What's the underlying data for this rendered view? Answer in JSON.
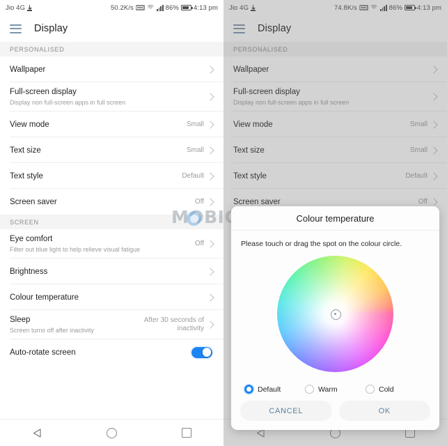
{
  "left": {
    "status_bar": {
      "carrier": "Jio 4G",
      "download_icon": "download-arrow-icon",
      "network_speed": "50.2K/s",
      "hd_icon": "hd-icon",
      "wifi_icon": "wifi-icon",
      "signal_icon": "signal-bars-icon",
      "battery_percent": "86%",
      "battery_icon": "battery-icon",
      "time": "4:13 pm"
    },
    "app_bar": {
      "menu_icon": "hamburger-menu-icon",
      "title": "Display"
    },
    "sections": [
      {
        "header": "PERSONALISED",
        "rows": [
          {
            "title": "Wallpaper",
            "sub": "",
            "value": "",
            "control": "chevron"
          },
          {
            "title": "Full-screen display",
            "sub": "Display non full-screen apps in full screen",
            "value": "",
            "control": "chevron"
          },
          {
            "title": "View mode",
            "sub": "",
            "value": "Small",
            "control": "chevron"
          },
          {
            "title": "Text size",
            "sub": "",
            "value": "Small",
            "control": "chevron"
          },
          {
            "title": "Text style",
            "sub": "",
            "value": "Default",
            "control": "chevron"
          },
          {
            "title": "Screen saver",
            "sub": "",
            "value": "Off",
            "control": "chevron"
          }
        ]
      },
      {
        "header": "SCREEN",
        "rows": [
          {
            "title": "Eye comfort",
            "sub": "Filter out blue light to help relieve visual fatigue",
            "value": "Off",
            "control": "chevron"
          },
          {
            "title": "Brightness",
            "sub": "",
            "value": "",
            "control": "chevron"
          },
          {
            "title": "Colour temperature",
            "sub": "",
            "value": "",
            "control": "chevron"
          },
          {
            "title": "Sleep",
            "sub": "Screen turns off after inactivity",
            "value": "After 30 seconds of inactivity",
            "control": "chevron"
          },
          {
            "title": "Auto-rotate screen",
            "sub": "",
            "value": "",
            "control": "toggle",
            "toggle_on": true
          }
        ]
      }
    ],
    "nav_bar": {
      "back_icon": "nav-back-triangle-icon",
      "home_icon": "nav-home-circle-icon",
      "recents_icon": "nav-recents-square-icon"
    }
  },
  "right": {
    "status_bar": {
      "carrier": "Jio 4G",
      "download_icon": "download-arrow-icon",
      "network_speed": "74.8K/s",
      "hd_icon": "hd-icon",
      "wifi_icon": "wifi-icon",
      "signal_icon": "signal-bars-icon",
      "battery_percent": "86%",
      "battery_icon": "battery-icon",
      "time": "4:13 pm"
    },
    "app_bar": {
      "menu_icon": "hamburger-menu-icon",
      "title": "Display"
    },
    "sections": [
      {
        "header": "PERSONALISED",
        "rows": [
          {
            "title": "Wallpaper",
            "sub": "",
            "value": "",
            "control": "chevron"
          },
          {
            "title": "Full-screen display",
            "sub": "Display non full-screen apps in full screen",
            "value": "",
            "control": "chevron"
          },
          {
            "title": "View mode",
            "sub": "",
            "value": "Small",
            "control": "chevron"
          },
          {
            "title": "Text size",
            "sub": "",
            "value": "Small",
            "control": "chevron"
          },
          {
            "title": "Text style",
            "sub": "",
            "value": "Default",
            "control": "chevron"
          },
          {
            "title": "Screen saver",
            "sub": "",
            "value": "Off",
            "control": "chevron"
          }
        ]
      }
    ],
    "nav_bar": {
      "back_icon": "nav-back-triangle-icon",
      "home_icon": "nav-home-circle-icon",
      "recents_icon": "nav-recents-square-icon"
    },
    "dialog": {
      "title": "Colour temperature",
      "hint": "Please touch or drag the spot on the colour circle.",
      "wheel_icon": "colour-wheel-picker",
      "spot_icon": "colour-spot-selector",
      "options": [
        {
          "label": "Default",
          "selected": true
        },
        {
          "label": "Warm",
          "selected": false
        },
        {
          "label": "Cold",
          "selected": false
        }
      ],
      "cancel_label": "CANCEL",
      "ok_label": "OK"
    }
  },
  "watermark": {
    "text": "MOBIGYAAN"
  },
  "colors": {
    "accent": "#1b84f2",
    "appbar_icon": "#7e94a8",
    "button_text": "#5b7f9c",
    "section_bg": "#f4f4f4"
  }
}
